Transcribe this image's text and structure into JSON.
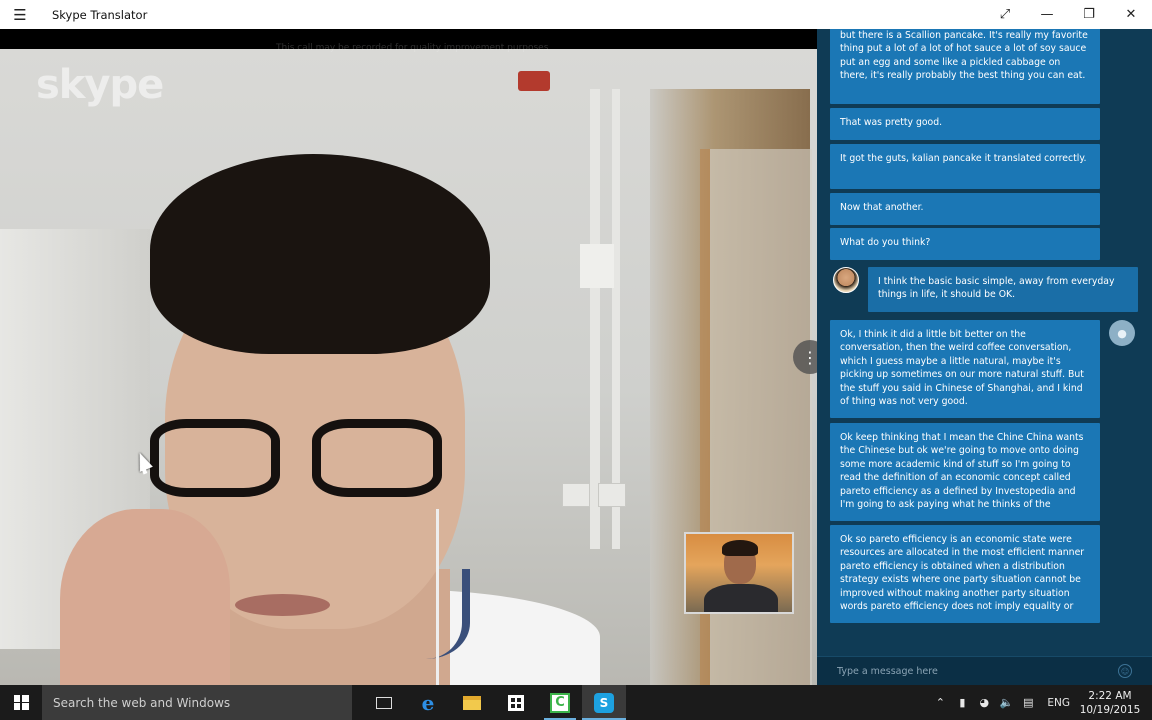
{
  "window": {
    "title": "Skype Translator",
    "menu_icon": "hamburger-icon",
    "controls": [
      "fullscreen-icon",
      "minimize-icon",
      "restore-icon",
      "close-icon"
    ]
  },
  "video": {
    "recording_notice": "This call may be recorded for quality improvement purposes",
    "watermark": "skype"
  },
  "chat": {
    "messages": [
      {
        "id": 0,
        "from": "other",
        "text": "but there is a Scallion pancake. It's really my favorite thing put a lot of a lot of hot sauce a lot of soy sauce put an egg and some like a pickled cabbage on there, it's really probably the best thing you can eat."
      },
      {
        "id": 1,
        "from": "other",
        "text": "That was pretty good."
      },
      {
        "id": 2,
        "from": "other",
        "text": "It got the guts, kalian pancake it translated correctly."
      },
      {
        "id": 3,
        "from": "other",
        "text": "Now that another."
      },
      {
        "id": 4,
        "from": "other",
        "text": "What do you think?"
      },
      {
        "id": 5,
        "from": "me",
        "text": "I think the basic basic simple, away from everyday things in life, it should be OK."
      },
      {
        "id": 6,
        "from": "other",
        "text": "Ok, I think it did a little bit better on the conversation, then the weird coffee conversation, which I guess maybe a little natural, maybe it's picking up sometimes on our more natural stuff. But the stuff you said in Chinese of Shanghai, and I kind of thing was not very good."
      },
      {
        "id": 7,
        "from": "other",
        "text": "Ok keep thinking that I mean the Chine China wants the Chinese but ok we're going to move onto doing some more academic kind of stuff so I'm going to read the definition of an economic concept called pareto efficiency as a defined by Investopedia and I'm going to ask paying what he thinks of the"
      },
      {
        "id": 8,
        "from": "other",
        "text": "Ok so pareto efficiency is an economic state were resources are allocated in the most efficient manner pareto efficiency is obtained when a distribution strategy exists where one party situation cannot be improved without making another party situation words pareto efficiency does not imply equality or"
      }
    ],
    "input_placeholder": "Type a message here",
    "colors": {
      "panel": "#0f3b55",
      "bubble": "#1b77b5"
    }
  },
  "taskbar": {
    "search_placeholder": "Search the web and Windows",
    "apps": [
      "task-view-icon",
      "edge-icon",
      "file-explorer-icon",
      "store-icon",
      "camtasia-icon",
      "skype-icon"
    ],
    "language": "ENG",
    "time": "2:22 AM",
    "date": "10/19/2015"
  }
}
